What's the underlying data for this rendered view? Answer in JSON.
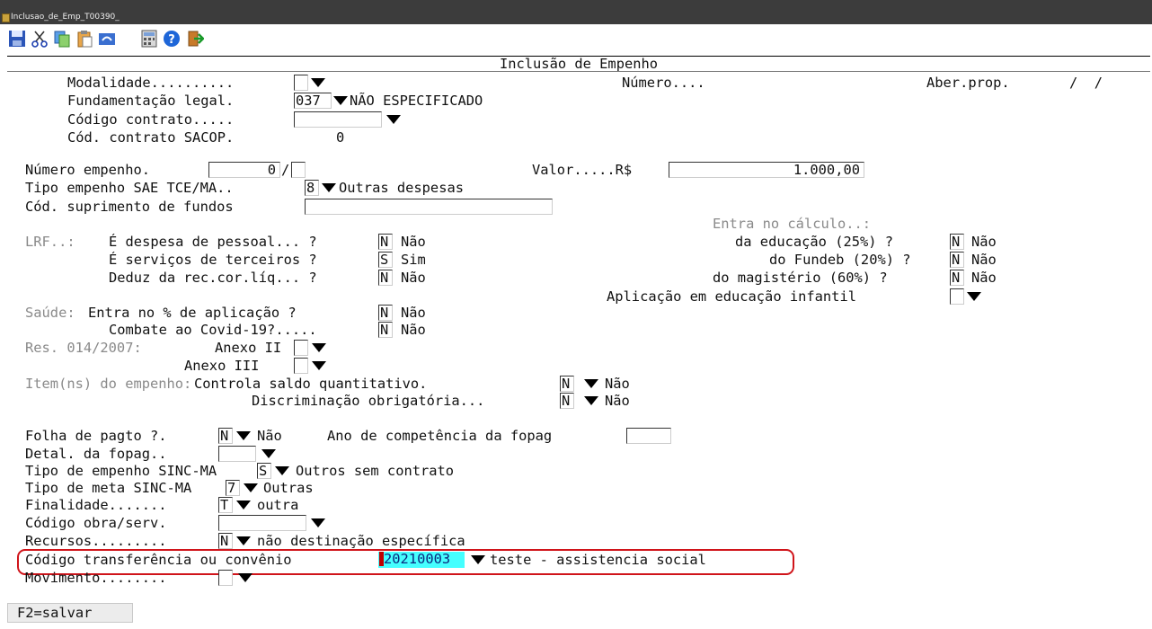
{
  "window": {
    "title": "Inclusao_de_Emp_T00390_"
  },
  "toolbar": {
    "buttons": [
      "save-icon",
      "cut-icon",
      "copy-icon",
      "paste-icon",
      "undo-icon",
      "calculator-icon",
      "help-icon",
      "exit-icon"
    ]
  },
  "header": {
    "title": "Inclusão de Empenho"
  },
  "form": {
    "modalidade": {
      "label": "Modalidade..........",
      "value": ""
    },
    "numero": {
      "label": "Número....",
      "value": ""
    },
    "aber_prop": {
      "label": "Aber.prop.",
      "value": "/  /"
    },
    "fundamentacao": {
      "label": "Fundamentação legal.",
      "value": "037",
      "desc": "NÃO ESPECIFICADO"
    },
    "codigo_contrato": {
      "label": "Código contrato.....",
      "value": ""
    },
    "cod_contrato_sacop": {
      "label": "Cód. contrato SACOP.",
      "value": "0"
    },
    "numero_empenho": {
      "label": "Número empenho.",
      "value": "0",
      "suffix": ""
    },
    "valor": {
      "label": "Valor.....R$",
      "value": "1.000,00"
    },
    "tipo_empenho_sae": {
      "label": "Tipo empenho SAE TCE/MA..",
      "value": "8",
      "desc": "Outras despesas"
    },
    "cod_suprimento": {
      "label": "Cód. suprimento de fundos",
      "value": ""
    },
    "entra_calculo": {
      "label": "Entra no cálculo..:"
    },
    "lrf": {
      "prefix": "LRF..:",
      "despesa_pessoal": {
        "label": "É despesa de pessoal... ?",
        "value": "N",
        "desc": "Não"
      },
      "servicos_terceiros": {
        "label": "É serviços de terceiros ?",
        "value": "S",
        "desc": "Sim"
      },
      "deduz_rec": {
        "label": "Deduz da rec.cor.líq... ?",
        "value": "N",
        "desc": "Não"
      }
    },
    "educacao": {
      "label": "da educação (25%) ?",
      "value": "N",
      "desc": "Não"
    },
    "fundeb": {
      "label": "do Fundeb (20%) ?",
      "value": "N",
      "desc": "Não"
    },
    "magisterio": {
      "label": "do magistério (60%) ?",
      "value": "N",
      "desc": "Não"
    },
    "educacao_infantil": {
      "label": "Aplicação em educação infantil",
      "value": ""
    },
    "saude": {
      "prefix": "Saúde:",
      "aplicacao": {
        "label": "Entra no % de aplicação ?",
        "value": "N",
        "desc": "Não"
      },
      "covid": {
        "label": "Combate ao Covid-19?.....",
        "value": "N",
        "desc": "Não"
      }
    },
    "res": {
      "prefix": "Res. 014/2007:",
      "anexo2": {
        "label": "Anexo II",
        "value": ""
      },
      "anexo3": {
        "label": "Anexo III",
        "value": ""
      }
    },
    "itens": {
      "prefix": "Item(ns) do empenho:",
      "controla_saldo": {
        "label": "Controla saldo quantitativo.",
        "value": "N",
        "desc": "Não"
      },
      "discriminacao": {
        "label": "Discriminação obrigatória...",
        "value": "N",
        "desc": "Não"
      }
    },
    "folha": {
      "label": "Folha de pagto ?.",
      "value": "N",
      "desc": "Não"
    },
    "ano_competencia": {
      "label": "Ano de competência da fopag",
      "value": ""
    },
    "detal_fopag": {
      "label": "Detal. da fopag..",
      "value": ""
    },
    "tipo_empenho_sinc": {
      "label": "Tipo de empenho SINC-MA",
      "value": "S",
      "desc": "Outros sem contrato"
    },
    "tipo_meta_sinc": {
      "label": "Tipo de meta SINC-MA",
      "value": "7",
      "desc": "Outras"
    },
    "finalidade": {
      "label": "Finalidade.......",
      "value": "T",
      "desc": "outra"
    },
    "codigo_obra": {
      "label": "Código obra/serv.",
      "value": ""
    },
    "recursos": {
      "label": "Recursos.........",
      "value": "N",
      "desc": "não destinação específica"
    },
    "transferencia": {
      "label": "Código transferência ou convênio",
      "value": "20210003",
      "desc": "teste - assistencia social"
    },
    "movimento": {
      "label": "Movimento........",
      "value": ""
    }
  },
  "footer": {
    "save_label": "F2=salvar"
  },
  "colors": {
    "highlight_bg": "#45ffff",
    "annotation_red": "#d0141a",
    "titlebar": "#3c3c3c"
  }
}
